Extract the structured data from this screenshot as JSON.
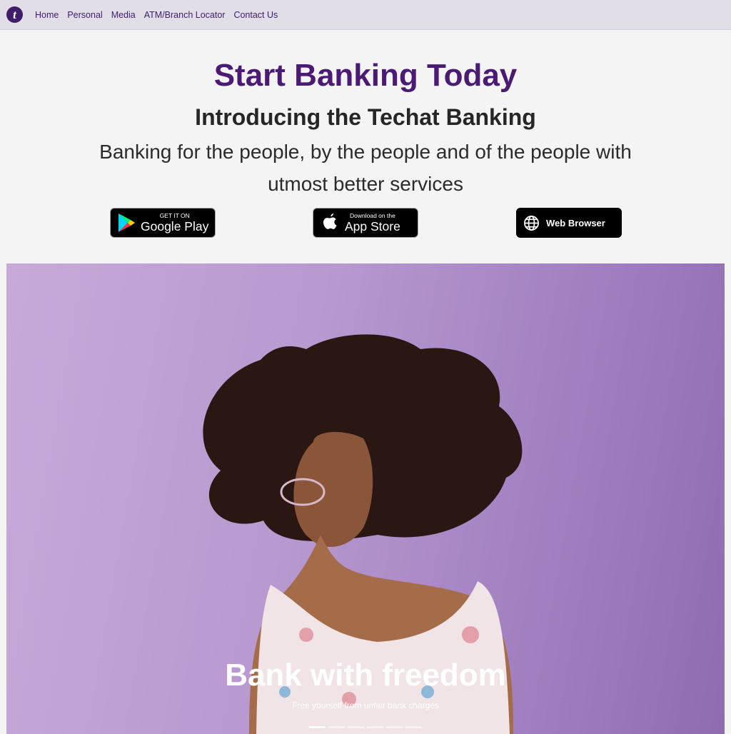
{
  "nav": {
    "logo_letter": "t",
    "links": [
      "Home",
      "Personal",
      "Media",
      "ATM/Branch Locator",
      "Contact Us"
    ]
  },
  "hero": {
    "title": "Start Banking Today",
    "subtitle": "Introducing the Techat Banking",
    "tagline": "Banking for the people, by the people and of the people with utmost better services"
  },
  "downloads": {
    "google_play": {
      "small": "GET IT ON",
      "big": "Google Play",
      "icon": "google-play-icon"
    },
    "app_store": {
      "small": "Download on the",
      "big": "App Store",
      "icon": "apple-icon"
    },
    "web": {
      "label": "Web Browser",
      "icon": "globe-icon"
    }
  },
  "carousel": {
    "slide_title": "Bank with freedom",
    "slide_subtitle": "Free yourself from unfair bank charges",
    "indicator_count": 6,
    "active_index": 0
  },
  "colors": {
    "brand": "#4a1a74",
    "nav_bg": "#e2dee8"
  }
}
